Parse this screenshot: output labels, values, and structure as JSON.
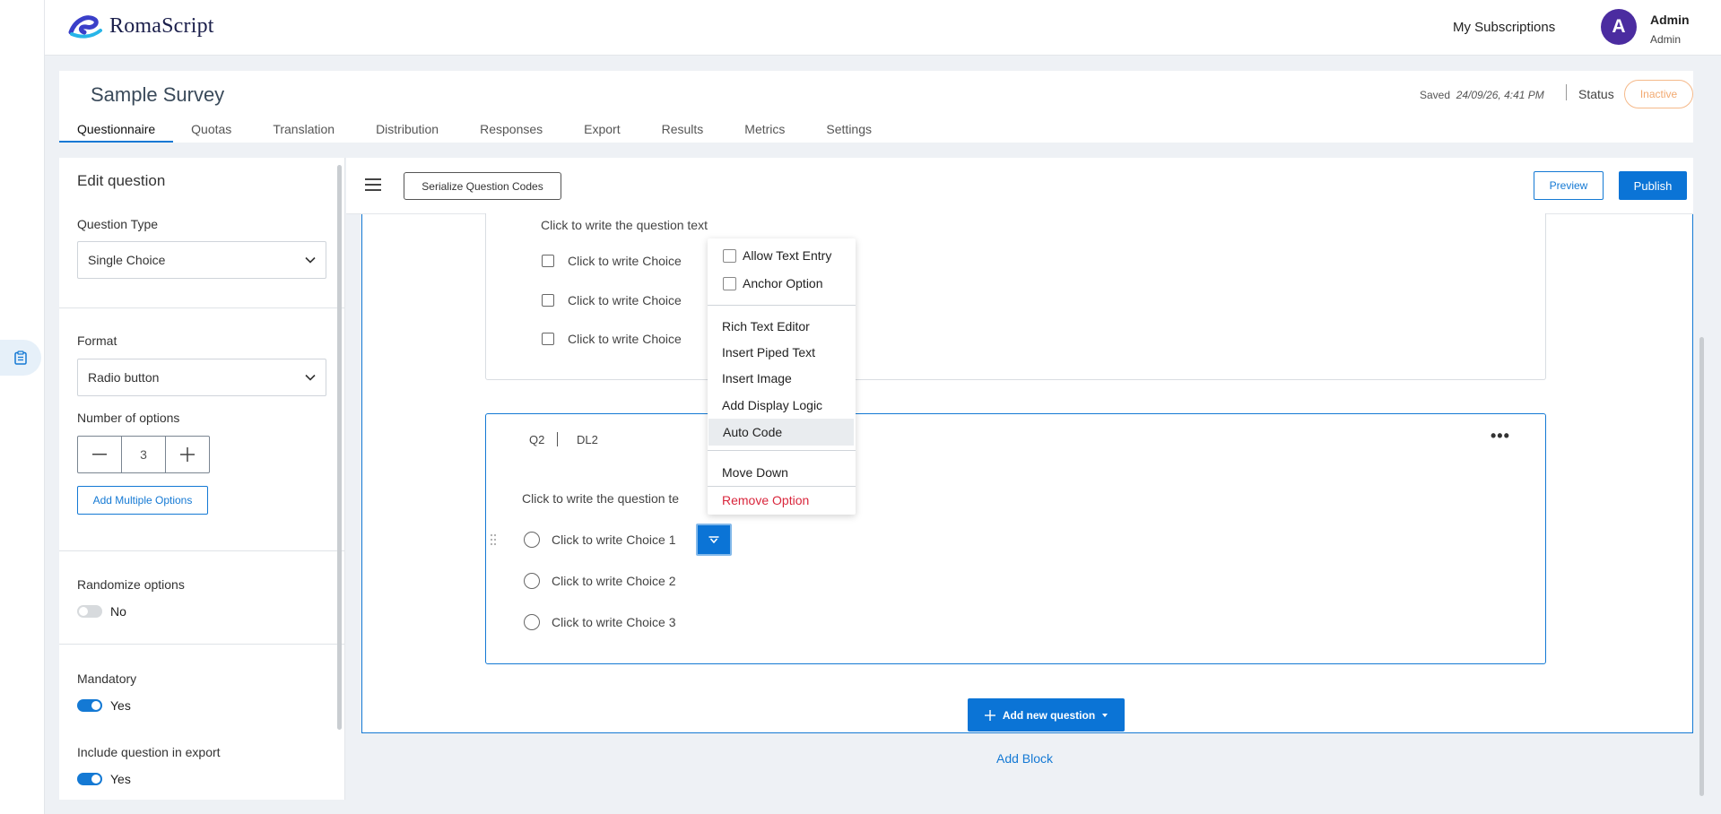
{
  "app": {
    "brand": "RomaScript"
  },
  "header": {
    "my_subscriptions": "My Subscriptions",
    "avatar_letter": "A",
    "user_name": "Admin",
    "user_role": "Admin"
  },
  "survey": {
    "title": "Sample Survey",
    "saved_label": "Saved",
    "saved_time": "24/09/26, 4:41 PM",
    "status_label": "Status",
    "status_value": "Inactive"
  },
  "tabs": [
    {
      "label": "Questionnaire",
      "active": true
    },
    {
      "label": "Quotas"
    },
    {
      "label": "Translation"
    },
    {
      "label": "Distribution"
    },
    {
      "label": "Responses"
    },
    {
      "label": "Export"
    },
    {
      "label": "Results"
    },
    {
      "label": "Metrics"
    },
    {
      "label": "Settings"
    }
  ],
  "editor": {
    "title": "Edit question",
    "question_type_label": "Question Type",
    "question_type_value": "Single Choice",
    "format_label": "Format",
    "format_value": "Radio button",
    "num_options_label": "Number of options",
    "num_options_value": "3",
    "add_multiple_options": "Add Multiple Options",
    "randomize_label": "Randomize options",
    "randomize_value": "No",
    "mandatory_label": "Mandatory",
    "mandatory_value": "Yes",
    "include_export_label": "Include question in export",
    "include_export_value": "Yes"
  },
  "toolbar": {
    "serialize": "Serialize Question Codes",
    "preview": "Preview",
    "publish": "Publish"
  },
  "q1": {
    "text": "Click to write the question text",
    "choices": [
      "Click to write Choice",
      "Click to write Choice",
      "Click to write Choice"
    ]
  },
  "q2": {
    "code": "Q2",
    "dl": "DL2",
    "text": "Click to write the question te",
    "choices": [
      "Click to write Choice 1",
      "Click to write Choice 2",
      "Click to write Choice 3"
    ]
  },
  "context_menu": {
    "allow_text_entry": "Allow Text Entry",
    "anchor_option": "Anchor Option",
    "rich_text_editor": "Rich Text Editor",
    "insert_piped_text": "Insert Piped Text",
    "insert_image": "Insert Image",
    "add_display_logic": "Add Display Logic",
    "auto_code": "Auto Code",
    "move_down": "Move Down",
    "remove_option": "Remove Option"
  },
  "actions": {
    "add_new_question": "Add new question",
    "add_block": "Add Block"
  }
}
